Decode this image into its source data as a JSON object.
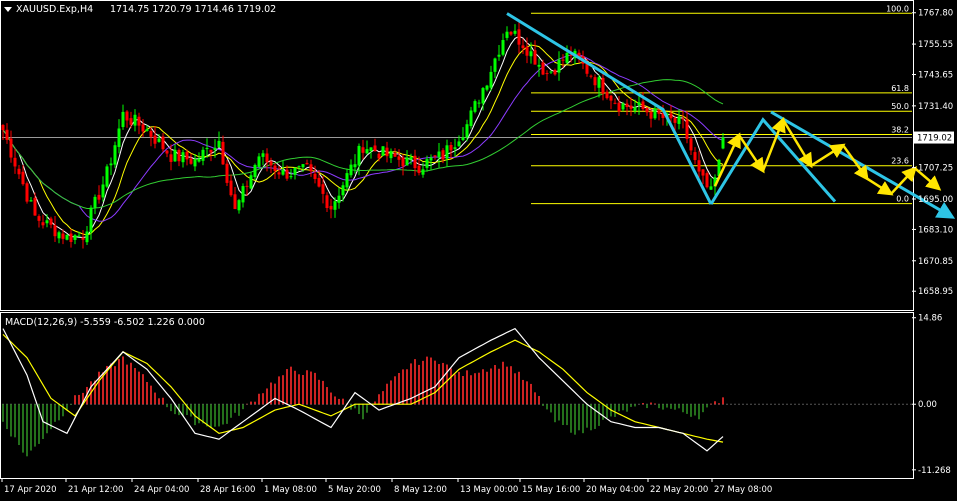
{
  "header": {
    "symbol_info": "XAUUSD.Exp,H4",
    "ohlc": "1714.75 1720.79 1714.46 1719.02",
    "dropdown_icon": "triangle-down-icon"
  },
  "indicator": {
    "label": "MACD(12,26,9) -5.559 -6.502 1.226 0.000"
  },
  "colors": {
    "background": "#000000",
    "bull_candle": "#00ff00",
    "bear_candle": "#ff0000",
    "ma_fast": "#ffffff",
    "ma_mid": "#ffff00",
    "ma_slow": "#8c3cff",
    "ma_long": "#32cd32",
    "fibonacci": "#ffff00",
    "trend_wave": "#2ec5e6",
    "projection": "#ffe600",
    "macd_pos_hist": "#ff2a2a",
    "macd_neg_hist": "#2e8b22",
    "axis_text": "#ffffff"
  },
  "chart_data": [
    {
      "type": "candlestick",
      "title": "XAUUSD.Exp,H4",
      "ylim": [
        1652.0,
        1772.0
      ],
      "y_ticks": [
        "1767.80",
        "1755.55",
        "1743.65",
        "1731.40",
        "1707.25",
        "1695.00",
        "1683.10",
        "1670.85",
        "1658.95"
      ],
      "current_price": "1719.02",
      "horizontal_line_price": 1719.02,
      "x_labels": [
        "17 Apr 2020",
        "21 Apr 12:00",
        "24 Apr 04:00",
        "28 Apr 16:00",
        "1 May 08:00",
        "5 May 20:00",
        "8 May 12:00",
        "13 May 00:00",
        "15 May 16:00",
        "20 May 04:00",
        "22 May 20:00",
        "27 May 08:00"
      ],
      "anchors": [
        [
          0,
          1722
        ],
        [
          8,
          1688
        ],
        [
          16,
          1680
        ],
        [
          20,
          1681
        ],
        [
          26,
          1705
        ],
        [
          30,
          1728
        ],
        [
          36,
          1722
        ],
        [
          42,
          1712
        ],
        [
          48,
          1710
        ],
        [
          54,
          1718
        ],
        [
          58,
          1690
        ],
        [
          64,
          1712
        ],
        [
          70,
          1705
        ],
        [
          76,
          1706
        ],
        [
          82,
          1692
        ],
        [
          90,
          1716
        ],
        [
          96,
          1712
        ],
        [
          104,
          1708
        ],
        [
          110,
          1712
        ],
        [
          116,
          1724
        ],
        [
          121,
          1742
        ],
        [
          126,
          1762
        ],
        [
          130,
          1756
        ],
        [
          136,
          1744
        ],
        [
          142,
          1752
        ],
        [
          148,
          1742
        ],
        [
          154,
          1732
        ],
        [
          160,
          1730
        ],
        [
          166,
          1726
        ],
        [
          170,
          1724
        ],
        [
          174,
          1704
        ],
        [
          177,
          1697
        ],
        [
          180,
          1714
        ]
      ],
      "fibonacci": {
        "levels": [
          {
            "label": "100.0",
            "price": 1767.6
          },
          {
            "label": "61.8",
            "price": 1736.5
          },
          {
            "label": "50.0",
            "price": 1729.3
          },
          {
            "label": "38.2",
            "price": 1720.2
          },
          {
            "label": "23.6",
            "price": 1708.0
          },
          {
            "label": "0.0",
            "price": 1693.2
          }
        ]
      },
      "wave_lines": [
        {
          "name": "down",
          "points": [
            [
              126,
              1767.5
            ],
            [
              165,
              1730
            ],
            [
              177,
              1693
            ]
          ]
        },
        {
          "name": "up_and_forecast",
          "points": [
            [
              177,
              1693
            ],
            [
              190,
              1726
            ],
            [
              208,
              1694
            ]
          ]
        }
      ],
      "projection_arrows": {
        "main_path": [
          [
            178,
            1700
          ],
          [
            184,
            1720
          ],
          [
            190,
            1706
          ],
          [
            195,
            1726
          ],
          [
            202,
            1708
          ],
          [
            210,
            1716
          ]
        ],
        "tail_path": [
          [
            210,
            1716
          ],
          [
            216,
            1703
          ],
          [
            222,
            1697
          ],
          [
            228,
            1707
          ],
          [
            234,
            1699
          ]
        ]
      }
    },
    {
      "type": "macd",
      "params": "12,26,9",
      "values": {
        "main": -5.559,
        "signal": -6.502,
        "histogram": 1.226
      },
      "ylim": [
        -12.5,
        15.5
      ],
      "y_ticks": [
        "14.86",
        "0.00",
        "-11.268"
      ],
      "hist_anchors": [
        [
          0,
          -3
        ],
        [
          6,
          -9
        ],
        [
          12,
          -4
        ],
        [
          18,
          1
        ],
        [
          24,
          5
        ],
        [
          30,
          8
        ],
        [
          36,
          4
        ],
        [
          42,
          -1
        ],
        [
          48,
          -3
        ],
        [
          54,
          -4
        ],
        [
          60,
          -1
        ],
        [
          66,
          3
        ],
        [
          72,
          6
        ],
        [
          78,
          5
        ],
        [
          84,
          1
        ],
        [
          90,
          -2
        ],
        [
          96,
          3
        ],
        [
          102,
          7
        ],
        [
          108,
          8
        ],
        [
          114,
          5
        ],
        [
          120,
          6
        ],
        [
          126,
          7
        ],
        [
          132,
          3
        ],
        [
          138,
          -3
        ],
        [
          144,
          -5
        ],
        [
          150,
          -3
        ],
        [
          156,
          -1
        ],
        [
          162,
          0
        ],
        [
          168,
          -1
        ],
        [
          174,
          -2
        ],
        [
          180,
          1.226
        ]
      ],
      "main_anchors": [
        [
          0,
          13
        ],
        [
          6,
          5
        ],
        [
          10,
          -3
        ],
        [
          16,
          -5
        ],
        [
          22,
          3
        ],
        [
          30,
          9
        ],
        [
          36,
          6
        ],
        [
          42,
          1
        ],
        [
          48,
          -5
        ],
        [
          54,
          -6
        ],
        [
          60,
          -3
        ],
        [
          68,
          1
        ],
        [
          74,
          -1
        ],
        [
          82,
          -4
        ],
        [
          88,
          2
        ],
        [
          94,
          -1
        ],
        [
          102,
          1
        ],
        [
          108,
          3
        ],
        [
          114,
          8
        ],
        [
          122,
          11
        ],
        [
          128,
          13
        ],
        [
          134,
          8
        ],
        [
          140,
          4
        ],
        [
          146,
          0
        ],
        [
          152,
          -3
        ],
        [
          158,
          -4
        ],
        [
          164,
          -4
        ],
        [
          170,
          -5
        ],
        [
          176,
          -8
        ],
        [
          180,
          -5.559
        ]
      ],
      "signal_anchors": [
        [
          0,
          12
        ],
        [
          6,
          8
        ],
        [
          12,
          1
        ],
        [
          18,
          -2
        ],
        [
          24,
          4
        ],
        [
          30,
          9
        ],
        [
          36,
          7
        ],
        [
          42,
          3
        ],
        [
          48,
          -2
        ],
        [
          54,
          -5
        ],
        [
          60,
          -4
        ],
        [
          68,
          -1
        ],
        [
          74,
          0
        ],
        [
          82,
          -2
        ],
        [
          88,
          0
        ],
        [
          94,
          0
        ],
        [
          102,
          0
        ],
        [
          108,
          2
        ],
        [
          114,
          6
        ],
        [
          122,
          9
        ],
        [
          128,
          11
        ],
        [
          134,
          9
        ],
        [
          140,
          6
        ],
        [
          146,
          2
        ],
        [
          152,
          -1
        ],
        [
          158,
          -3
        ],
        [
          164,
          -4
        ],
        [
          170,
          -5
        ],
        [
          176,
          -6
        ],
        [
          180,
          -6.502
        ]
      ]
    }
  ]
}
